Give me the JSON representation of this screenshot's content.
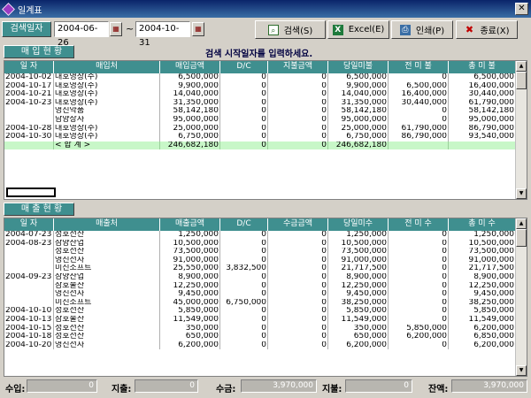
{
  "window": {
    "title": "일계표",
    "close_glyph": "✕"
  },
  "toolbar": {
    "search_label": "검색일자",
    "date_from": "2004-06-26",
    "date_to": "2004-10-31",
    "tilde": "~",
    "buttons": {
      "search": "검색(S)",
      "excel": "Excel(E)",
      "print": "인쇄(P)",
      "exit": "종료(X)"
    }
  },
  "message": "검색 시작일자를 입력하세요.",
  "purchase": {
    "title": "매 입 현 황",
    "columns": [
      "일 자",
      "매입처",
      "매입금액",
      "D/C",
      "지불금액",
      "당일미불",
      "전 미 불",
      "총 미 불"
    ],
    "rows": [
      [
        "2004-10-02",
        "대호영상(주)",
        "6,500,000",
        "0",
        "0",
        "6,500,000",
        "0",
        "6,500,000"
      ],
      [
        "2004-10-17",
        "대호영상(주)",
        "9,900,000",
        "0",
        "0",
        "9,900,000",
        "6,500,000",
        "16,400,000"
      ],
      [
        "2004-10-21",
        "대호영상(주)",
        "14,040,000",
        "0",
        "0",
        "14,040,000",
        "16,400,000",
        "30,440,000"
      ],
      [
        "2004-10-23",
        "대호영상(주)",
        "31,350,000",
        "0",
        "0",
        "31,350,000",
        "30,440,000",
        "61,790,000"
      ],
      [
        "",
        "영진약품",
        "58,142,180",
        "0",
        "0",
        "58,142,180",
        "0",
        "58,142,180"
      ],
      [
        "",
        "남양상사",
        "95,000,000",
        "0",
        "0",
        "95,000,000",
        "0",
        "95,000,000"
      ],
      [
        "2004-10-28",
        "대호영상(주)",
        "25,000,000",
        "0",
        "0",
        "25,000,000",
        "61,790,000",
        "86,790,000"
      ],
      [
        "2004-10-30",
        "대호영상(주)",
        "6,750,000",
        "0",
        "0",
        "6,750,000",
        "86,790,000",
        "93,540,000"
      ]
    ],
    "total": [
      "",
      "< 합     계 >",
      "246,682,180",
      "0",
      "0",
      "246,682,180",
      "",
      ""
    ]
  },
  "sales": {
    "title": "매 출 현 황",
    "columns": [
      "일 자",
      "매출처",
      "매출금액",
      "D/C",
      "수금금액",
      "당일미수",
      "전 미 수",
      "총 미 수"
    ],
    "rows": [
      [
        "2004-07-23",
        "성호전산",
        "1,250,000",
        "0",
        "0",
        "1,250,000",
        "0",
        "1,250,000"
      ],
      [
        "2004-08-23",
        "삼양산업",
        "10,500,000",
        "0",
        "0",
        "10,500,000",
        "0",
        "10,500,000"
      ],
      [
        "",
        "성호전산",
        "73,500,000",
        "0",
        "0",
        "73,500,000",
        "0",
        "73,500,000"
      ],
      [
        "",
        "영진전자",
        "91,000,000",
        "0",
        "0",
        "91,000,000",
        "0",
        "91,000,000"
      ],
      [
        "",
        "미진소프트",
        "25,550,000",
        "3,832,500",
        "0",
        "21,717,500",
        "0",
        "21,717,500"
      ],
      [
        "2004-09-23",
        "삼양산업",
        "8,900,000",
        "0",
        "0",
        "8,900,000",
        "0",
        "8,900,000"
      ],
      [
        "",
        "삼호물산",
        "12,250,000",
        "0",
        "0",
        "12,250,000",
        "0",
        "12,250,000"
      ],
      [
        "",
        "영진전자",
        "9,450,000",
        "0",
        "0",
        "9,450,000",
        "0",
        "9,450,000"
      ],
      [
        "",
        "미진소프트",
        "45,000,000",
        "6,750,000",
        "0",
        "38,250,000",
        "0",
        "38,250,000"
      ],
      [
        "2004-10-10",
        "성호전산",
        "5,850,000",
        "0",
        "0",
        "5,850,000",
        "0",
        "5,850,000"
      ],
      [
        "2004-10-13",
        "삼호물산",
        "11,549,000",
        "0",
        "0",
        "11,549,000",
        "0",
        "11,549,000"
      ],
      [
        "2004-10-15",
        "성호전산",
        "350,000",
        "0",
        "0",
        "350,000",
        "5,850,000",
        "6,200,000"
      ],
      [
        "2004-10-18",
        "성호전산",
        "650,000",
        "0",
        "0",
        "650,000",
        "6,200,000",
        "6,850,000"
      ],
      [
        "2004-10-20",
        "영진전자",
        "6,200,000",
        "0",
        "0",
        "6,200,000",
        "0",
        "6,200,000"
      ]
    ]
  },
  "footer": {
    "income_label": "수입:",
    "income": "0",
    "expense_label": "지출:",
    "expense": "0",
    "collect_label": "수금:",
    "collect": "3,970,000",
    "payment_label": "지불:",
    "payment": "0",
    "balance_label": "잔액:",
    "balance": "3,970,000"
  },
  "colors": {
    "teal_header": "#3f8f8f",
    "total_row": "#c8f7c8",
    "title_bar": "#0a246a"
  }
}
